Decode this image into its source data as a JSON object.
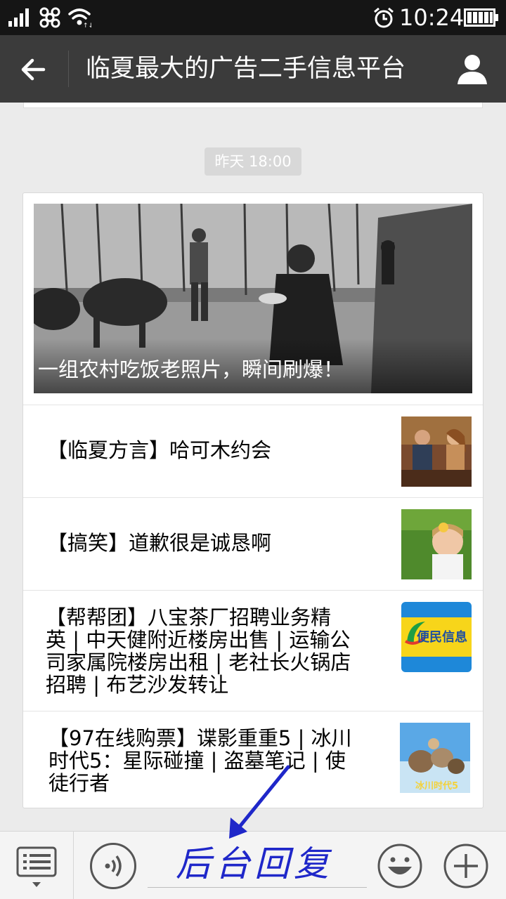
{
  "status_bar": {
    "time": "10:24",
    "icons": [
      "signal-icon",
      "unicom-logo-icon",
      "wifi-icon",
      "alarm-icon",
      "battery-icon"
    ]
  },
  "header": {
    "title": "临夏最大的广告二手信息平台",
    "icons": [
      "back-arrow-icon",
      "profile-icon"
    ]
  },
  "timestamp": "昨天 18:00",
  "article": {
    "cover_caption": "一组农村吃饭老照片，瞬间刷爆！",
    "items": [
      {
        "title": "【临夏方言】哈可木约会",
        "thumb": "couple-dining"
      },
      {
        "title": "【搞笑】道歉很是诚恳啊",
        "thumb": "child-on-grass"
      },
      {
        "title": "【帮帮团】八宝茶厂招聘业务精英 | 中天健附近楼房出售 | 运输公司家属院楼房出租 | 老社长火锅店招聘 | 布艺沙发转让",
        "lines": [
          "【帮帮团】八宝茶厂招聘业务精",
          "英 | 中天健附近楼房出售 | 运输公",
          "司家属院楼房出租 | 老社长火锅店",
          "招聘 | 布艺沙发转让"
        ],
        "thumb": "便民信息"
      },
      {
        "title": "【97在线购票】谍影重重5 | 冰川时代5：星际碰撞 | 盗墓笔记 | 使徒行者",
        "lines": [
          "【97在线购票】谍影重重5 | 冰川",
          "时代5：星际碰撞 | 盗墓笔记 | 使",
          "徒行者"
        ],
        "thumb": "冰川时代5"
      }
    ]
  },
  "bottom_bar": {
    "icons": [
      "menu-list-icon",
      "voice-icon",
      "emoji-icon",
      "plus-icon"
    ],
    "annotation": "后台回复"
  },
  "colors": {
    "status_bar": "#151515",
    "title_bar": "#3b3b3b",
    "background": "#ebebeb",
    "annotation": "#1f27c9"
  }
}
